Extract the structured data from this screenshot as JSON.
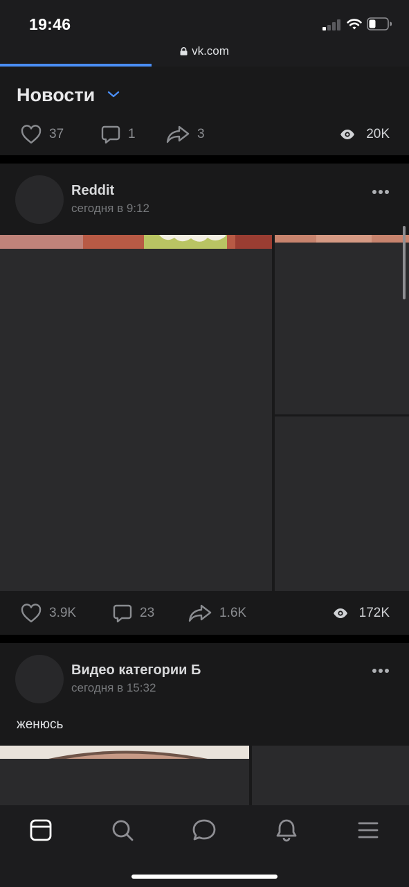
{
  "status_bar": {
    "time": "19:46"
  },
  "browser": {
    "url": "vk.com",
    "load_progress_percent": 37
  },
  "feed": {
    "title": "Новости",
    "top_post_stats": {
      "likes": "37",
      "comments": "1",
      "shares": "3",
      "views": "20K"
    }
  },
  "posts": [
    {
      "author": "Reddit",
      "time": "сегодня в 9:12",
      "stats": {
        "likes": "3.9K",
        "comments": "23",
        "shares": "1.6K",
        "views": "172K"
      }
    },
    {
      "author": "Видео категории Б",
      "time": "сегодня в 15:32",
      "text": "женюсь"
    }
  ],
  "tabs": [
    "feed-icon",
    "search-icon",
    "messages-icon",
    "notifications-icon",
    "menu-icon"
  ],
  "colors": {
    "accent": "#4a8ef5",
    "card": "#19191a",
    "placeholder": "#2a2a2c"
  }
}
